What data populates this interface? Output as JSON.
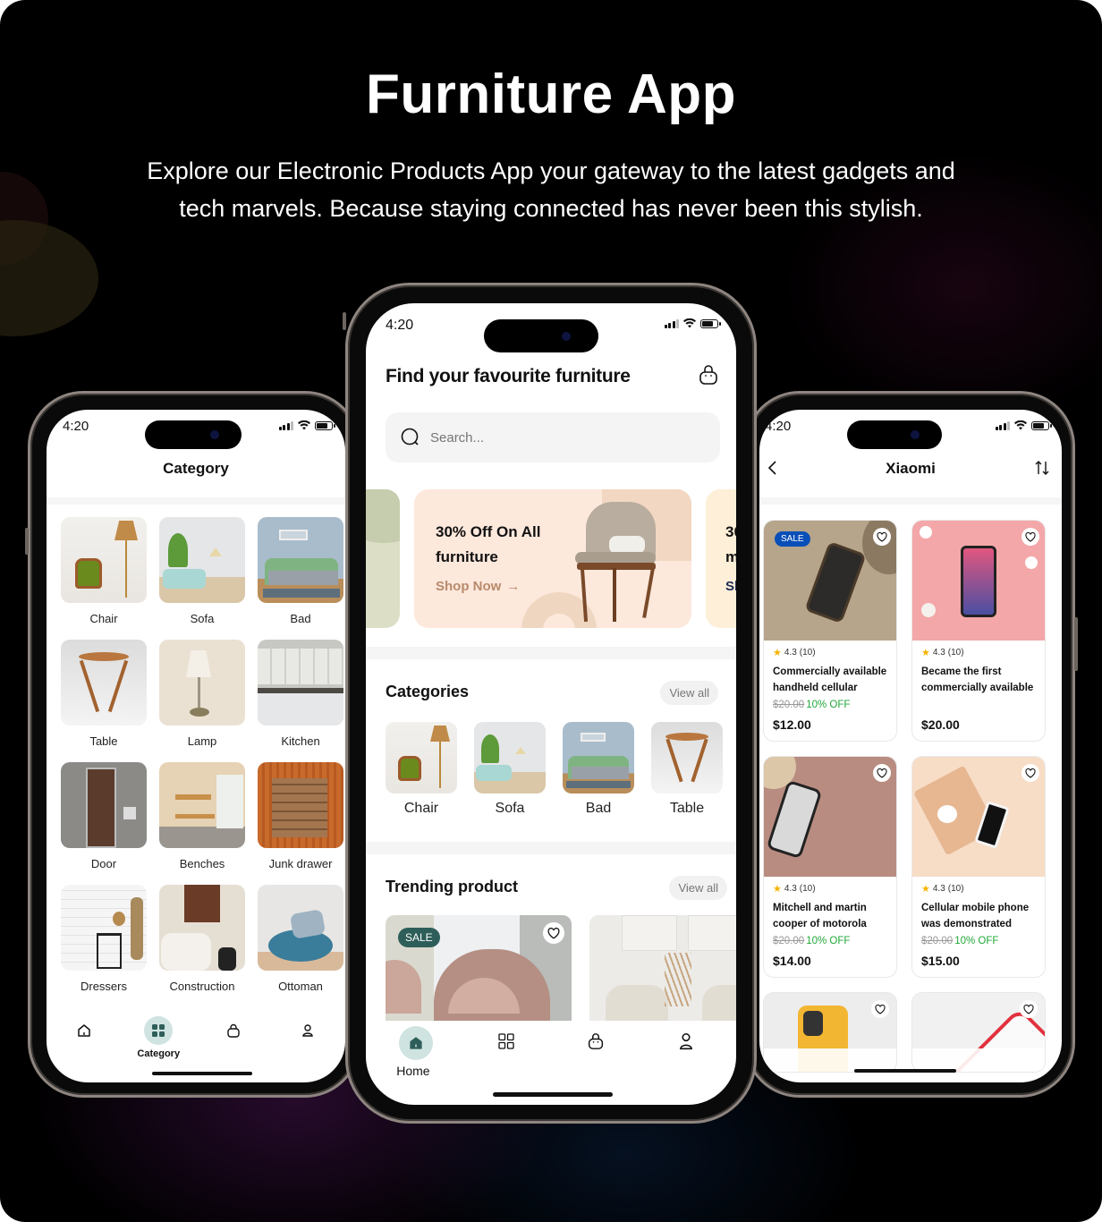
{
  "hero": {
    "title": "Furniture App",
    "subtitle_line1": "Explore our Electronic Products App your gateway to the latest gadgets and",
    "subtitle_line2": "tech marvels. Because staying connected has never been this stylish."
  },
  "status_bar": {
    "time": "4:20"
  },
  "category_screen": {
    "title": "Category",
    "items": [
      {
        "label": "Chair",
        "icon": "chair-image"
      },
      {
        "label": "Sofa",
        "icon": "sofa-image"
      },
      {
        "label": "Bad",
        "icon": "bed-image"
      },
      {
        "label": "Table",
        "icon": "table-image"
      },
      {
        "label": "Lamp",
        "icon": "lamp-image"
      },
      {
        "label": "Kitchen",
        "icon": "kitchen-image"
      },
      {
        "label": "Door",
        "icon": "door-image"
      },
      {
        "label": "Benches",
        "icon": "bench-image"
      },
      {
        "label": "Junk drawer",
        "icon": "drawer-image"
      },
      {
        "label": "Dressers",
        "icon": "dresser-image"
      },
      {
        "label": "Construction",
        "icon": "construction-image"
      },
      {
        "label": "Ottoman",
        "icon": "ottoman-image"
      }
    ],
    "tabbar": {
      "active_label": "Category"
    }
  },
  "home_screen": {
    "heading": "Find your favourite furniture",
    "search_placeholder": "Search...",
    "banner": {
      "title": "30% Off On All furniture",
      "cta": "Shop Now",
      "next_title_partial": "30\nm",
      "next_cta_partial": "Sh"
    },
    "categories": {
      "title": "Categories",
      "view_all": "View all",
      "items": [
        {
          "label": "Chair"
        },
        {
          "label": "Sofa"
        },
        {
          "label": "Bad"
        },
        {
          "label": "Table"
        }
      ]
    },
    "trending": {
      "title": "Trending product",
      "view_all": "View all",
      "sale_badge": "SALE"
    },
    "tabbar": {
      "active_label": "Home"
    }
  },
  "brand_screen": {
    "title": "Xiaomi",
    "products": [
      {
        "sale": "SALE",
        "rating": "4.3",
        "reviews": "(10)",
        "name": "Commercially available handheld cellular",
        "old_price": "$20.00",
        "discount": "10% OFF",
        "price": "$12.00"
      },
      {
        "sale": "",
        "rating": "4.3",
        "reviews": "(10)",
        "name": "Became the first commercially available",
        "old_price": "",
        "discount": "",
        "price": "$20.00"
      },
      {
        "sale": "",
        "rating": "4.3",
        "reviews": "(10)",
        "name": "Mitchell and martin cooper of motorola",
        "old_price": "$20.00",
        "discount": "10% OFF",
        "price": "$14.00"
      },
      {
        "sale": "",
        "rating": "4.3",
        "reviews": "(10)",
        "name": "Cellular mobile phone was demonstrated",
        "old_price": "$20.00",
        "discount": "10% OFF",
        "price": "$15.00"
      }
    ]
  },
  "colors": {
    "accent_teal": "#2e5e59",
    "active_tab_bg": "#cfe3e1",
    "sale_blue": "#0a4fb8",
    "discount_green": "#22a83a",
    "banner_bg": "#fde8dc",
    "shop_now": "#b98a6c"
  }
}
